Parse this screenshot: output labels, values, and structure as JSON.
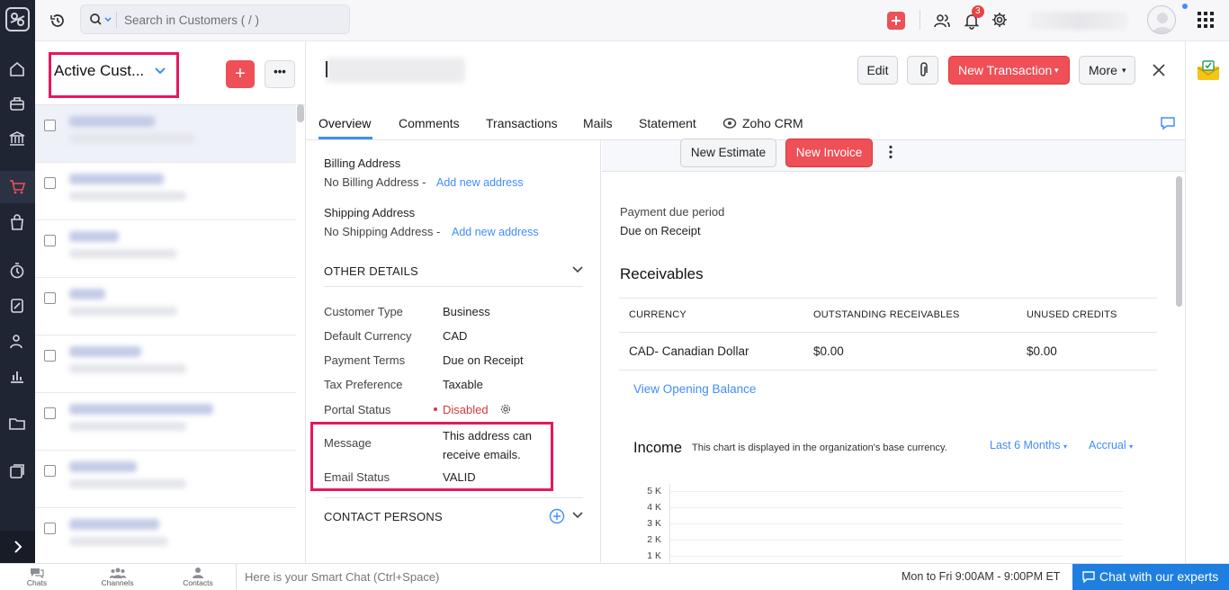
{
  "topbar": {
    "search_placeholder": "Search in Customers ( / )",
    "notification_count": "3"
  },
  "list": {
    "view_title": "Active Cust...",
    "add_label": "+",
    "more_label": "•••"
  },
  "header": {
    "buttons": {
      "edit": "Edit",
      "new_transaction": "New Transaction",
      "more": "More"
    },
    "tabs": [
      "Overview",
      "Comments",
      "Transactions",
      "Mails",
      "Statement",
      "Zoho CRM"
    ]
  },
  "details": {
    "billing_label": "Billing Address",
    "billing_value": "No Billing Address -",
    "billing_link": "Add new address",
    "shipping_label": "Shipping Address",
    "shipping_value": "No Shipping Address -",
    "shipping_link": "Add new address",
    "other_details_title": "OTHER DETAILS",
    "rows": [
      {
        "label": "Customer Type",
        "value": "Business"
      },
      {
        "label": "Default Currency",
        "value": "CAD"
      },
      {
        "label": "Payment Terms",
        "value": "Due on Receipt"
      },
      {
        "label": "Tax Preference",
        "value": "Taxable"
      },
      {
        "label": "Portal Status",
        "value": "Disabled"
      },
      {
        "label": "Message",
        "value": "This address can receive emails."
      },
      {
        "label": "Email Status",
        "value": "VALID"
      }
    ],
    "contact_persons_title": "CONTACT PERSONS"
  },
  "overview": {
    "new_estimate": "New Estimate",
    "new_invoice": "New Invoice",
    "payment_due_label": "Payment due period",
    "payment_due_value": "Due on Receipt",
    "receivables_title": "Receivables",
    "receivables_headers": [
      "CURRENCY",
      "OUTSTANDING RECEIVABLES",
      "UNUSED CREDITS"
    ],
    "receivables_row": [
      "CAD- Canadian Dollar",
      "$0.00",
      "$0.00"
    ],
    "opening_balance_link": "View Opening Balance",
    "income_title": "Income",
    "income_note": "This chart is displayed in the organization's base currency.",
    "period_dropdown": "Last 6 Months",
    "basis_dropdown": "Accrual"
  },
  "chart_data": {
    "type": "bar",
    "yticks": [
      "5 K",
      "4 K",
      "3 K",
      "2 K",
      "1 K"
    ],
    "ylim": [
      0,
      5000
    ],
    "grid": true
  },
  "bottombar": {
    "chats": "Chats",
    "channels": "Channels",
    "contacts": "Contacts",
    "smart_chat": "Here is your Smart Chat (Ctrl+Space)",
    "hours": "Mon to Fri 9:00AM - 9:00PM ET",
    "chat_button": "Chat with our experts"
  },
  "colors": {
    "accent_red": "#ef4f56",
    "link_blue": "#408dfb",
    "highlight_box": "#e5185f",
    "sidebar_bg": "#1f2533"
  }
}
